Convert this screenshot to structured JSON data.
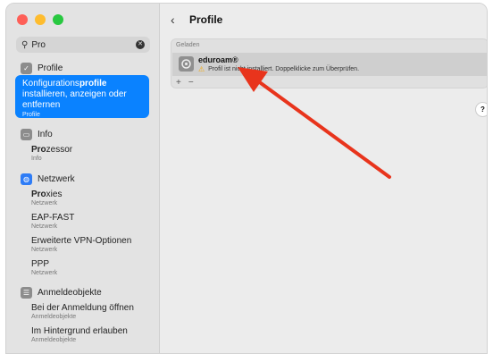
{
  "search": {
    "value": "Pro"
  },
  "sidebar": {
    "profile_group": {
      "label": "Profile"
    },
    "selected_item": {
      "text_before": "Konfigurations",
      "text_highlight": "profile",
      "text_after": " installieren, anzeigen oder entfernen",
      "sub": "Profile"
    },
    "info_group": {
      "label": "Info",
      "items": [
        {
          "highlight": "Pro",
          "rest": "zessor",
          "sub": "Info"
        }
      ]
    },
    "network_group": {
      "label": "Netzwerk",
      "items": [
        {
          "highlight": "Pro",
          "rest": "xies",
          "sub": "Netzwerk"
        },
        {
          "highlight": "",
          "rest": "EAP-FAST",
          "sub": "Netzwerk"
        },
        {
          "highlight": "",
          "rest": "Erweiterte VPN-Optionen",
          "sub": "Netzwerk"
        },
        {
          "highlight": "",
          "rest": "PPP",
          "sub": "Netzwerk"
        }
      ]
    },
    "login_group": {
      "label": "Anmeldeobjekte",
      "items": [
        {
          "highlight": "",
          "rest": "Bei der Anmeldung öffnen",
          "sub": "Anmeldeobjekte"
        },
        {
          "highlight": "",
          "rest": "Im Hintergrund erlauben",
          "sub": "Anmeldeobjekte"
        }
      ]
    }
  },
  "main": {
    "title": "Profile",
    "panel_title": "Geladen",
    "profile_name": "eduroam®",
    "profile_status": "Profil ist nicht installiert. Doppelklicke zum Überprüfen.",
    "add_label": "+",
    "remove_label": "−",
    "help_label": "?"
  },
  "colors": {
    "accent": "#0a82ff",
    "arrow": "#e8341c"
  }
}
